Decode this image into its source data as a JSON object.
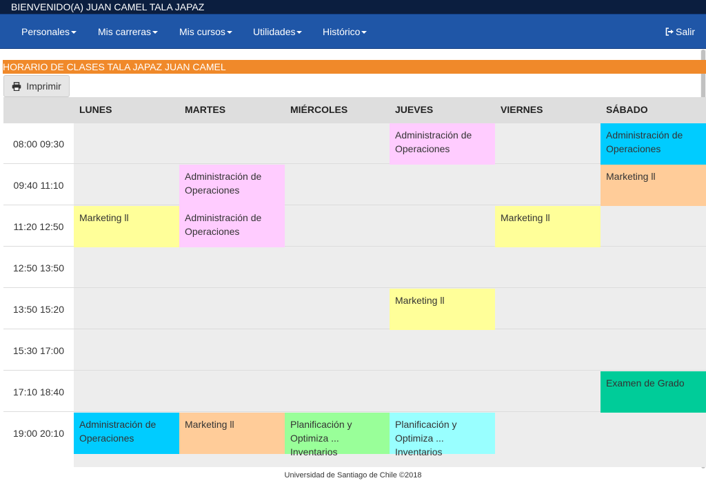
{
  "welcome": "BIENVENIDO(A) JUAN CAMEL TALA JAPAZ",
  "nav": {
    "items": [
      "Personales",
      "Mis carreras",
      "Mis cursos",
      "Utilidades",
      "Histórico"
    ],
    "logout": "Salir"
  },
  "schedule": {
    "title": "HORARIO DE CLASES TALA JAPAZ JUAN CAMEL",
    "print_label": "Imprimir",
    "days": [
      "LUNES",
      "MARTES",
      "MIÉRCOLES",
      "JUEVES",
      "VIERNES",
      "SÁBADO"
    ],
    "times": [
      "08:00 09:30",
      "09:40 11:10",
      "11:20 12:50",
      "12:50 13:50",
      "13:50 15:20",
      "15:30 17:00",
      "17:10 18:40",
      "19:00 20:10"
    ],
    "entries": [
      {
        "day": 3,
        "slot": 0,
        "label": "Administración de Operaciones",
        "color": "#ffccff"
      },
      {
        "day": 5,
        "slot": 0,
        "label": "Administración de Operaciones",
        "color": "#00ccff"
      },
      {
        "day": 1,
        "slot": 1,
        "label": "Administración de Operaciones",
        "color": "#ffccff"
      },
      {
        "day": 5,
        "slot": 1,
        "label": "Marketing ll",
        "color": "#ffcc99"
      },
      {
        "day": 0,
        "slot": 2,
        "label": "Marketing ll",
        "color": "#ffff99"
      },
      {
        "day": 1,
        "slot": 2,
        "label": "Administración de Operaciones",
        "color": "#ffccff"
      },
      {
        "day": 4,
        "slot": 2,
        "label": "Marketing ll",
        "color": "#ffff99"
      },
      {
        "day": 3,
        "slot": 4,
        "label": "Marketing ll",
        "color": "#ffff99"
      },
      {
        "day": 5,
        "slot": 6,
        "label": "Examen de Grado",
        "color": "#00cc99"
      },
      {
        "day": 0,
        "slot": 7,
        "label": "Administración de Operaciones",
        "color": "#00ccff"
      },
      {
        "day": 1,
        "slot": 7,
        "label": "Marketing ll",
        "color": "#ffcc99"
      },
      {
        "day": 2,
        "slot": 7,
        "label": "Planificación y Optimiza ... Inventarios",
        "color": "#99ff99"
      },
      {
        "day": 3,
        "slot": 7,
        "label": "Planificación y Optimiza ... Inventarios",
        "color": "#99ffff"
      }
    ]
  },
  "footer": "Universidad de Santiago de Chile ©2018"
}
